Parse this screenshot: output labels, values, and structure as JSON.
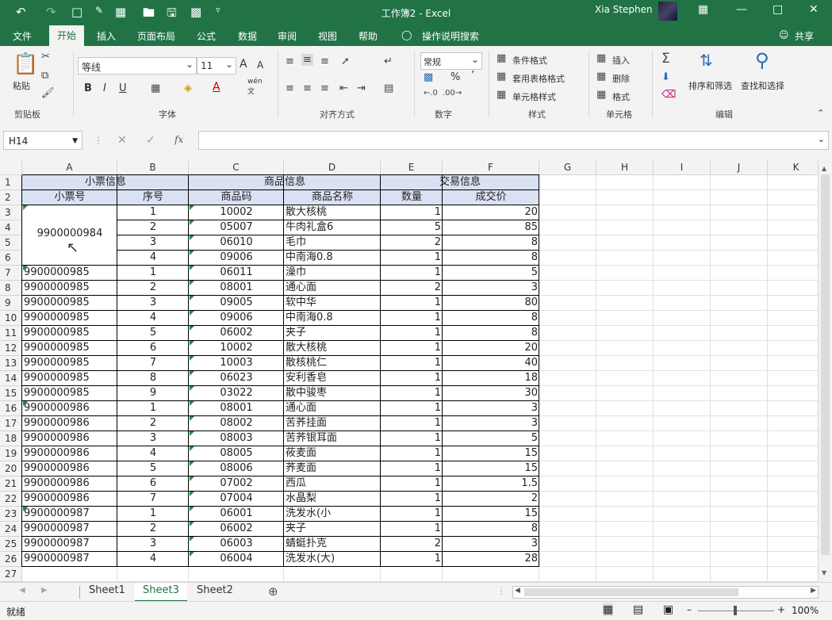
{
  "title_bar": {
    "doc": "工作簿2",
    "sep": " - ",
    "app": "Excel",
    "user": "Xia Stephen"
  },
  "tabs": [
    "文件",
    "开始",
    "插入",
    "页面布局",
    "公式",
    "数据",
    "审阅",
    "视图",
    "帮助",
    "操作说明搜索"
  ],
  "share": "共享",
  "ribbon": {
    "clipboard": {
      "paste": "粘贴",
      "group": "剪贴板"
    },
    "font": {
      "name": "等线",
      "size": "11",
      "bold": "B",
      "italic": "I",
      "underline": "U",
      "grow": "A",
      "shrink": "A",
      "wen": "wén",
      "wen2": "文",
      "group": "字体"
    },
    "align": {
      "group": "对齐方式"
    },
    "number": {
      "format": "常规",
      "percent": "%",
      "comma": "’",
      "group": "数字"
    },
    "styles": {
      "cond": "条件格式",
      "table": "套用表格格式",
      "cell": "单元格样式",
      "group": "样式"
    },
    "cells": {
      "insert": "插入",
      "delete": "删除",
      "format": "格式",
      "group": "单元格"
    },
    "editing": {
      "sort": "排序和筛选",
      "find": "查找和选择",
      "group": "编辑"
    }
  },
  "formula_bar": {
    "name_box": "H14",
    "fx": "fx",
    "value": ""
  },
  "columns": [
    "A",
    "B",
    "C",
    "D",
    "E",
    "F",
    "G",
    "H",
    "I",
    "J",
    "K"
  ],
  "rows": [
    "1",
    "2",
    "3",
    "4",
    "5",
    "6",
    "7",
    "8",
    "9",
    "10",
    "11",
    "12",
    "13",
    "14",
    "15",
    "16",
    "17",
    "18",
    "19",
    "20",
    "21",
    "22",
    "23",
    "24",
    "25",
    "26",
    "27"
  ],
  "header_row1": {
    "receipt_info": "小票信息",
    "product_info": "商品信息",
    "trade_info": "交易信息"
  },
  "header_row2": {
    "receipt_no": "小票号",
    "seq": "序号",
    "code": "商品码",
    "name": "商品名称",
    "qty": "数量",
    "price": "成交价"
  },
  "merged_receipt": "9900000984",
  "table_rows": [
    {
      "receipt": "",
      "seq": "1",
      "code": "10002",
      "name": "散大核桃",
      "qty": "1",
      "price": "20"
    },
    {
      "receipt": "",
      "seq": "2",
      "code": "05007",
      "name": "牛肉礼盒6",
      "qty": "5",
      "price": "85"
    },
    {
      "receipt": "",
      "seq": "3",
      "code": "06010",
      "name": "毛巾",
      "qty": "2",
      "price": "8"
    },
    {
      "receipt": "",
      "seq": "4",
      "code": "09006",
      "name": "中南海0.8",
      "qty": "1",
      "price": "8"
    },
    {
      "receipt": "9900000985",
      "seq": "1",
      "code": "06011",
      "name": "澡巾",
      "qty": "1",
      "price": "5"
    },
    {
      "receipt": "9900000985",
      "seq": "2",
      "code": "08001",
      "name": "通心面",
      "qty": "2",
      "price": "3"
    },
    {
      "receipt": "9900000985",
      "seq": "3",
      "code": "09005",
      "name": "软中华",
      "qty": "1",
      "price": "80"
    },
    {
      "receipt": "9900000985",
      "seq": "4",
      "code": "09006",
      "name": "中南海0.8",
      "qty": "1",
      "price": "8"
    },
    {
      "receipt": "9900000985",
      "seq": "5",
      "code": "06002",
      "name": "夹子",
      "qty": "1",
      "price": "8"
    },
    {
      "receipt": "9900000985",
      "seq": "6",
      "code": "10002",
      "name": "散大核桃",
      "qty": "1",
      "price": "20"
    },
    {
      "receipt": "9900000985",
      "seq": "7",
      "code": "10003",
      "name": "散核桃仁",
      "qty": "1",
      "price": "40"
    },
    {
      "receipt": "9900000985",
      "seq": "8",
      "code": "06023",
      "name": "安利香皂",
      "qty": "1",
      "price": "18"
    },
    {
      "receipt": "9900000985",
      "seq": "9",
      "code": "03022",
      "name": "散中骏枣",
      "qty": "1",
      "price": "30"
    },
    {
      "receipt": "9900000986",
      "seq": "1",
      "code": "08001",
      "name": "通心面",
      "qty": "1",
      "price": "3"
    },
    {
      "receipt": "9900000986",
      "seq": "2",
      "code": "08002",
      "name": "苦荞挂面",
      "qty": "1",
      "price": "3"
    },
    {
      "receipt": "9900000986",
      "seq": "3",
      "code": "08003",
      "name": "苦荞银耳面",
      "qty": "1",
      "price": "5"
    },
    {
      "receipt": "9900000986",
      "seq": "4",
      "code": "08005",
      "name": "莜麦面",
      "qty": "1",
      "price": "15"
    },
    {
      "receipt": "9900000986",
      "seq": "5",
      "code": "08006",
      "name": "荞麦面",
      "qty": "1",
      "price": "15"
    },
    {
      "receipt": "9900000986",
      "seq": "6",
      "code": "07002",
      "name": "西瓜",
      "qty": "1",
      "price": "1.5"
    },
    {
      "receipt": "9900000986",
      "seq": "7",
      "code": "07004",
      "name": "水晶梨",
      "qty": "1",
      "price": "2"
    },
    {
      "receipt": "9900000987",
      "seq": "1",
      "code": "06001",
      "name": "洗发水(小",
      "qty": "1",
      "price": "15"
    },
    {
      "receipt": "9900000987",
      "seq": "2",
      "code": "06002",
      "name": "夹子",
      "qty": "1",
      "price": "8"
    },
    {
      "receipt": "9900000987",
      "seq": "3",
      "code": "06003",
      "name": "蜻蜓扑克",
      "qty": "2",
      "price": "3"
    },
    {
      "receipt": "9900000987",
      "seq": "4",
      "code": "06004",
      "name": "洗发水(大)",
      "qty": "1",
      "price": "28"
    }
  ],
  "sheets": [
    "Sheet1",
    "Sheet3",
    "Sheet2"
  ],
  "active_sheet": "Sheet3",
  "status": {
    "ready": "就绪",
    "zoom": "100%"
  },
  "colors": {
    "brand": "#217346",
    "header_fill": "#d9e1f2",
    "error_triangle": "#1e8c3a"
  }
}
